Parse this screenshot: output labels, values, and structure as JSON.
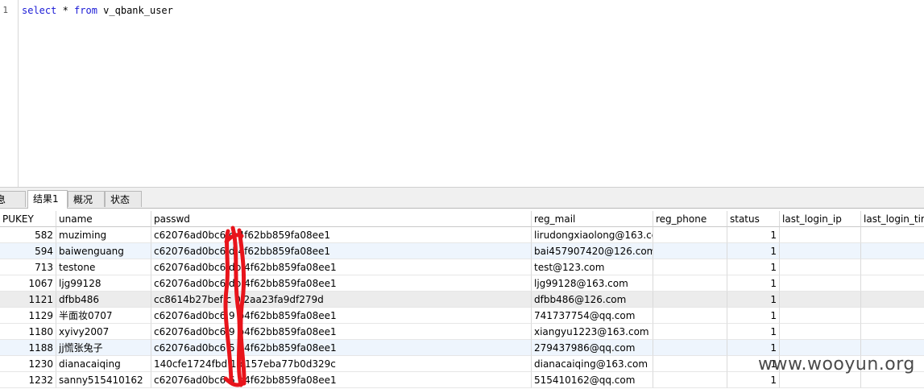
{
  "editor": {
    "line_number": "1",
    "sql": {
      "kw1": "select",
      "mid1": " * ",
      "kw2": "from",
      "rest": " v_qbank_user"
    }
  },
  "tabs": [
    {
      "label": "息",
      "active": false
    },
    {
      "label": "结果1",
      "active": true
    },
    {
      "label": "概况",
      "active": false
    },
    {
      "label": "状态",
      "active": false
    }
  ],
  "table": {
    "columns": [
      "PUKEY",
      "uname",
      "passwd",
      "reg_mail",
      "reg_phone",
      "status",
      "last_login_ip",
      "last_login_tim"
    ],
    "rows": [
      [
        "582",
        "muziming",
        "c62076ad0bc6  d  4f62bb859fa08ee1",
        "lirudongxiaolong@163.co",
        "",
        "1",
        "",
        ""
      ],
      [
        "594",
        "baiwenguang",
        "c62076ad0bc6  d  4f62bb859fa08ee1",
        "bai457907420@126.com",
        "",
        "1",
        "",
        ""
      ],
      [
        "713",
        "testone",
        "c62076ad0bc6  db 4f62bb859fa08ee1",
        "test@123.com",
        "",
        "1",
        "",
        ""
      ],
      [
        "1067",
        "ljg99128",
        "c62076ad0bc6  db 4f62bb859fa08ee1",
        "ljg99128@163.com",
        "",
        "1",
        "",
        ""
      ],
      [
        "1121",
        "dfbb486",
        "cc8614b27bef  c  0 2aa23fa9df279d",
        "dfbb486@126.com",
        "",
        "1",
        "",
        ""
      ],
      [
        "1129",
        "半面妆0707",
        "c62076ad0bc6  9  b4f62bb859fa08ee1",
        "741737754@qq.com",
        "",
        "1",
        "",
        ""
      ],
      [
        "1180",
        "xyivy2007",
        "c62076ad0bc6  9  b4f62bb859fa08ee1",
        "xiangyu1223@163.com",
        "",
        "1",
        "",
        ""
      ],
      [
        "1188",
        "jj慌张兔子",
        "c62076ad0bc6  5  b4f62bb859fa08ee1",
        "279437986@qq.com",
        "",
        "1",
        "",
        ""
      ],
      [
        "1230",
        "dianacaiqing",
        "140cfe1724fbd  1  c157eba77b0d329c",
        "dianacaiqing@163.com",
        "",
        "1",
        "",
        ""
      ],
      [
        "1232",
        "sanny515410162",
        "c62076ad0bc6  6  b4f62bb859fa08ee1",
        "515410162@qq.com",
        "",
        "1",
        "",
        ""
      ]
    ]
  },
  "watermark": "www.wooyun.org",
  "colors": {
    "keyword": "#1a1ad6",
    "redaction": "#e8141b",
    "row_highlight": "#eef5fd"
  }
}
